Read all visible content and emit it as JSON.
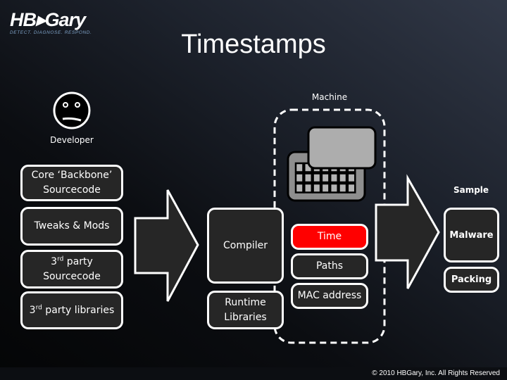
{
  "header": {
    "logo_text": "HB▸Gary",
    "logo_tagline": "DETECT. DIAGNOSE. RESPOND.",
    "title": "Timestamps"
  },
  "developer": {
    "icon": "sad-face-icon",
    "label": "Developer"
  },
  "sources": [
    {
      "label": "Core ‘Backbone’ Sourcecode"
    },
    {
      "label": "Tweaks & Mods"
    },
    {
      "prefix": "3",
      "sup": "rd",
      "label": " party Sourcecode"
    },
    {
      "prefix": "3",
      "sup": "rd",
      "label": " party libraries"
    }
  ],
  "build": {
    "compiler": "Compiler",
    "runtime": "Runtime Libraries"
  },
  "machine": {
    "label": "Machine",
    "icon": "computer-keyboard-icon",
    "attributes": [
      {
        "label": "Time",
        "highlighted": true
      },
      {
        "label": "Paths",
        "highlighted": false
      },
      {
        "label": "MAC address",
        "highlighted": false
      }
    ]
  },
  "sample": {
    "label": "Sample",
    "items": [
      {
        "label": "Malware"
      },
      {
        "label": "Packing"
      }
    ]
  },
  "colors": {
    "highlight": "#ff0000",
    "box_fill": "#262626",
    "box_border": "#ffffff",
    "logo_tagline": "#7fa3c8"
  },
  "footer": {
    "copyright": "© 2010 HBGary, Inc. All Rights Reserved"
  }
}
